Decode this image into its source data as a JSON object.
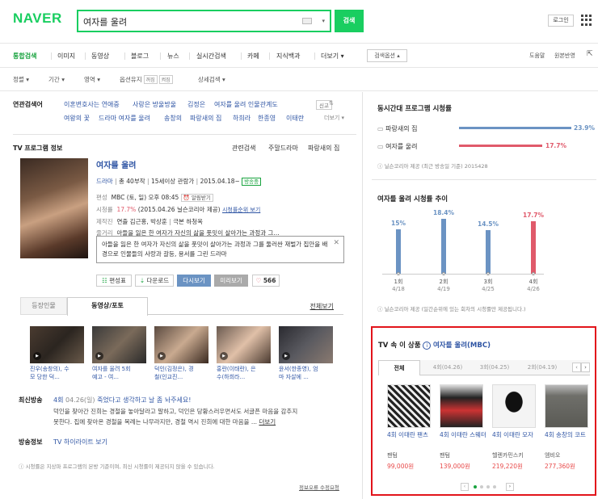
{
  "header": {
    "logo": "NAVER",
    "search_value": "여자를 울려",
    "search_button": "검색",
    "login": "로그인"
  },
  "tabs": [
    "통합검색",
    "이미지",
    "동영상",
    "블로그",
    "뉴스",
    "실시간검색",
    "카페",
    "지식백과",
    "더보기"
  ],
  "tab_more_arrow": "▾",
  "search_options": "검색옵션",
  "right_links": [
    "도움말",
    "원본반영"
  ],
  "filters": {
    "items": [
      "정렬",
      "기간",
      "영역",
      "옵션유지",
      "상세검색"
    ],
    "chips": [
      "꺼짐",
      "켜짐"
    ]
  },
  "related": {
    "label": "연관검색어",
    "row1": [
      "이혼변호사는 연애중",
      "사랑은 방울방울",
      "김정은",
      "여자를 울려 인물관계도"
    ],
    "row2": [
      "여왕의 꽃",
      "드라마 여자를 울려",
      "송창의",
      "파랑새의 집",
      "하희라",
      "한종영",
      "이태란"
    ],
    "report": "신고",
    "more": "더보기"
  },
  "tv_info": {
    "section_title": "TV 프로그램 정보",
    "links": [
      "관련검색",
      "주말드라마",
      "파랑새의 집"
    ],
    "title": "여자를 울려",
    "meta": [
      "드라마",
      "총 40부작",
      "15세이상 관람가",
      "2015.04.18~",
      "방송중"
    ],
    "channel_label": "편성",
    "channel_value": "MBC (토, 일) 오후 08:45",
    "alarm": "알림받기",
    "rating_label": "시청률",
    "rating_value": "17.7%",
    "rating_detail": "(2015.04.26 닐슨코리아 제공)",
    "rating_link": "시청률순위 보기",
    "crew_label": "제작진",
    "crew_value_1": "연출 김근홍, 박상훈",
    "crew_value_2": "극본 하청옥",
    "plot_label": "줄거리",
    "plot_value": "아들을 잃은 한 여자가 자신의 삶을 풋밋이 살아가는 과정과 그...",
    "tooltip": "아들을 잃은 한 여자가 자신의 삶을 풋밋이 살아가는 과정과 그를 둘러싼 재벌가 집안을 배경으로 인물들의 사랑과 갈등, 용서를 그린 드라마",
    "buttons": [
      "편성표",
      "다운로드",
      "다시보기",
      "미리보기"
    ],
    "like_count": "566"
  },
  "video": {
    "tabs": [
      "등장인물",
      "동영상/포토"
    ],
    "all_link": "전체보기",
    "items": [
      {
        "line1": "진우(송창의), 수",
        "line2": "모 당한 덕..."
      },
      {
        "line1": "여자를 울려 5회",
        "line2": "예고 - 여..."
      },
      {
        "line1": "덕인(김정은), 경",
        "line2": "철(인교진..."
      },
      {
        "line1": "홍란(이태란), 은",
        "line2": "수(하희라..."
      },
      {
        "line1": "윤서(한종영), 엄",
        "line2": "마 자살에 ..."
      }
    ]
  },
  "latest": {
    "label": "최신방송",
    "episode": "4회",
    "date": "04.26(일)",
    "headline": "죽었다고 생각하고 날 좀 놔주세요!",
    "text_line1": "덕인을 찾아간 진희는 경철을 놓아달라고 말하고, 덕인은 당황스러우면서도 서글픈 마음을 감추지",
    "text_line2": "못한다. 집에 찾아온 경철을 복례는 나무라지만, 경철 역시 진희에 대한 마음을 ...",
    "more": "더보기"
  },
  "broadcast": {
    "label": "방송정보",
    "link": "TV 하이라이트 보기"
  },
  "left_footer": {
    "note": "시청률은 지상파 프로그램의 본방 기준이며, 최신 시청률이 제공되지 않을 수 있습니다.",
    "error_link": "정보오류 수정요청"
  },
  "ratings_panel": {
    "title": "동시간대 프로그램 시청률",
    "rows": [
      {
        "name": "파랑새의 집",
        "value": "23.9%",
        "color": "#6b93c3"
      },
      {
        "name": "여자를 울려",
        "value": "17.7%",
        "color": "#e05a6b"
      }
    ],
    "source": "닐슨코리아 제공 (최근 방송일 기준) 2015428"
  },
  "trend": {
    "title": "여자를 울려 시청률 추이",
    "source": "닐슨코리아 제공 (일간순위에 있는 회차의 시청률만 제공됩니다.)"
  },
  "chart_data": {
    "type": "bar",
    "categories": [
      "1회",
      "2회",
      "3회",
      "4회"
    ],
    "dates": [
      "4/18",
      "4/19",
      "4/25",
      "4/26"
    ],
    "values": [
      15,
      18.4,
      14.5,
      17.7
    ],
    "value_labels": [
      "15%",
      "18.4%",
      "14.5%",
      "17.7%"
    ],
    "colors": [
      "#6b93c3",
      "#6b93c3",
      "#6b93c3",
      "#e05a6b"
    ],
    "label_colors": [
      "#6b93c3",
      "#6b93c3",
      "#6b93c3",
      "#e05a6b"
    ]
  },
  "products": {
    "title": "TV 속 이 상품",
    "info": "i",
    "program": "여자를 울려(MBC)",
    "tabs": [
      "전체",
      "4회(04.26)",
      "3회(04.25)",
      "2회(04.19)"
    ],
    "items": [
      {
        "name": "4회 이태란 팬츠",
        "shop": "팬텀",
        "price": "99,000원"
      },
      {
        "name": "4회 이태란 스웨터",
        "shop": "팬텀",
        "price": "139,000원"
      },
      {
        "name": "4회 이태란 모자",
        "shop": "헬렌카민스키",
        "price": "219,220원"
      },
      {
        "name": "4회 송창의 코트",
        "shop": "엠비오",
        "price": "277,360원"
      }
    ]
  },
  "colors": {
    "brand": "#19ce60",
    "link": "#2f55a4",
    "highlight_box": "#e2141b"
  }
}
